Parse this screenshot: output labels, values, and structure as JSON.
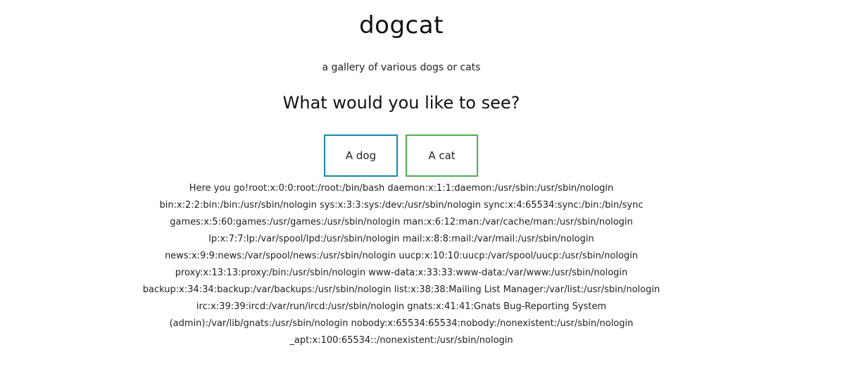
{
  "header": {
    "title": "dogcat",
    "subtitle": "a gallery of various dogs or cats"
  },
  "main": {
    "prompt": "What would you like to see?",
    "buttons": {
      "dog_label": "A dog",
      "cat_label": "A cat"
    },
    "colors": {
      "dog_border": "#1a87a8",
      "cat_border": "#4caf50"
    },
    "result_text": "Here you go!root:x:0:0:root:/root:/bin/bash daemon:x:1:1:daemon:/usr/sbin:/usr/sbin/nologin bin:x:2:2:bin:/bin:/usr/sbin/nologin sys:x:3:3:sys:/dev:/usr/sbin/nologin sync:x:4:65534:sync:/bin:/bin/sync games:x:5:60:games:/usr/games:/usr/sbin/nologin man:x:6:12:man:/var/cache/man:/usr/sbin/nologin lp:x:7:7:lp:/var/spool/lpd:/usr/sbin/nologin mail:x:8:8:mail:/var/mail:/usr/sbin/nologin news:x:9:9:news:/var/spool/news:/usr/sbin/nologin uucp:x:10:10:uucp:/var/spool/uucp:/usr/sbin/nologin proxy:x:13:13:proxy:/bin:/usr/sbin/nologin www-data:x:33:33:www-data:/var/www:/usr/sbin/nologin backup:x:34:34:backup:/var/backups:/usr/sbin/nologin list:x:38:38:Mailing List Manager:/var/list:/usr/sbin/nologin irc:x:39:39:ircd:/var/run/ircd:/usr/sbin/nologin gnats:x:41:41:Gnats Bug-Reporting System (admin):/var/lib/gnats:/usr/sbin/nologin nobody:x:65534:65534:nobody:/nonexistent:/usr/sbin/nologin _apt:x:100:65534::/nonexistent:/usr/sbin/nologin"
  }
}
